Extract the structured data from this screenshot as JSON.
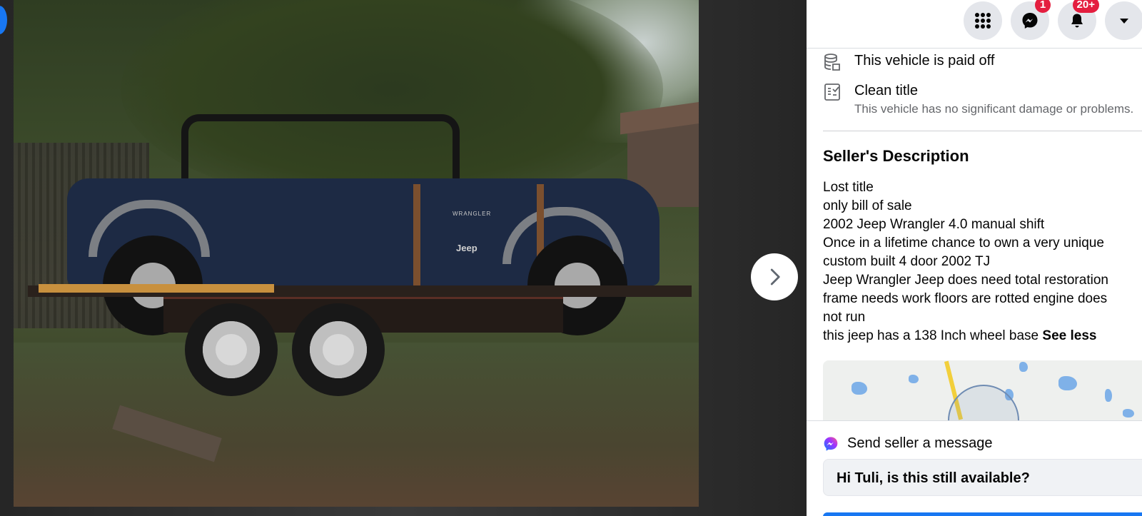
{
  "viewer": {
    "photo_alt": "",
    "next_icon": "chevron-right-icon"
  },
  "topbar": {
    "menu_icon": "grid-menu-icon",
    "messenger_icon": "messenger-icon",
    "messenger_count": "1",
    "notifications_icon": "bell-icon",
    "notifications_count": "20+",
    "account_icon": "caret-down-icon"
  },
  "attributes": [
    {
      "icon": "stack-coins-icon",
      "title": "This vehicle is paid off",
      "subtitle": ""
    },
    {
      "icon": "document-title-icon",
      "title": "Clean title",
      "subtitle": "This vehicle has no significant damage or problems."
    }
  ],
  "seller_description": {
    "title": "Seller's Description",
    "lines": [
      "Lost title",
      "only bill of sale",
      "2002 Jeep Wrangler 4.0 manual shift",
      "Once in a lifetime chance to own a very unique",
      "custom built 4 door 2002 TJ",
      "Jeep Wrangler Jeep does need total restoration",
      "frame needs work floors are rotted engine does",
      "not run",
      "this jeep has a 138 Inch wheel base"
    ],
    "see_less": "See less"
  },
  "message": {
    "title": "Send seller a message",
    "input_value": "Hi Tuli, is this still available?"
  },
  "photo_text": {
    "badge": "Jeep",
    "model": "WRANGLER"
  },
  "colors": {
    "accent": "#1877f2",
    "badge_red": "#e41e3f"
  }
}
